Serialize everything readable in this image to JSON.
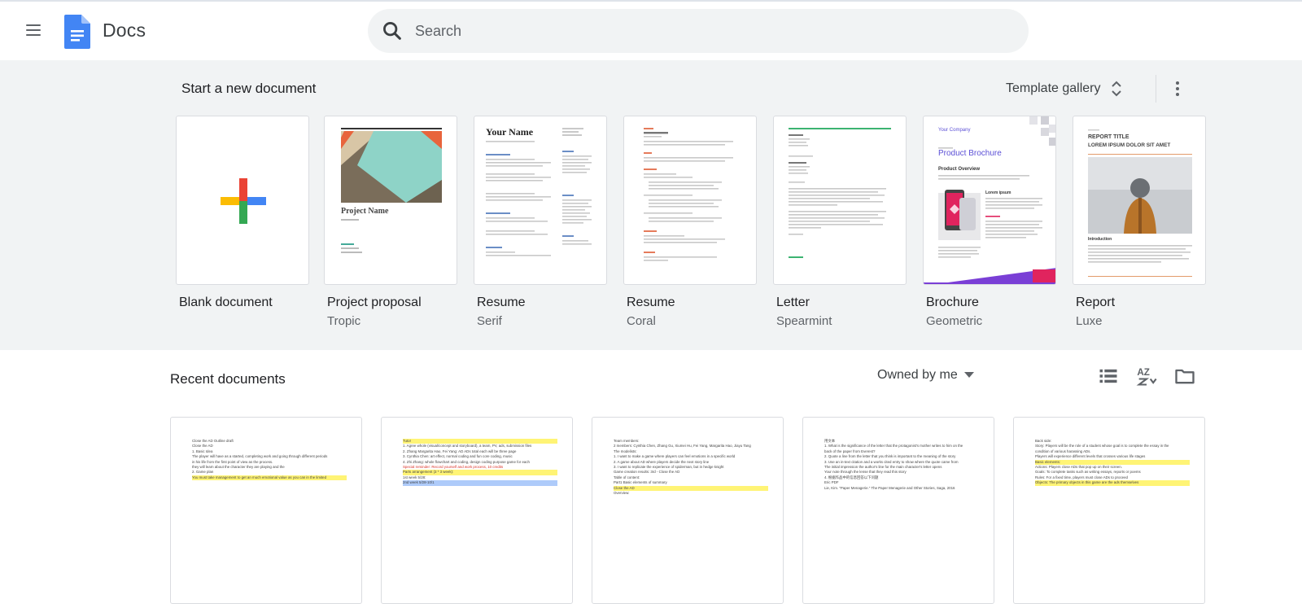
{
  "app": {
    "name": "Docs"
  },
  "search": {
    "placeholder": "Search"
  },
  "templates_section": {
    "title": "Start a new document",
    "gallery_label": "Template gallery",
    "items": [
      {
        "name": "Blank document",
        "subtitle": ""
      },
      {
        "name": "Project proposal",
        "subtitle": "Tropic"
      },
      {
        "name": "Resume",
        "subtitle": "Serif"
      },
      {
        "name": "Resume",
        "subtitle": "Coral"
      },
      {
        "name": "Letter",
        "subtitle": "Spearmint"
      },
      {
        "name": "Brochure",
        "subtitle": "Geometric"
      },
      {
        "name": "Report",
        "subtitle": "Luxe"
      }
    ],
    "thumb_text": {
      "project_name": "Project Name",
      "your_name": "Your Name",
      "company": "Your Company",
      "product_brochure": "Product Brochure",
      "product_overview": "Product Overview",
      "lorem_ipsum": "Lorem ipsum",
      "report_title": "REPORT TITLE",
      "report_sub": "LOREM IPSUM DOLOR SIT AMET",
      "introduction": "Introduction"
    }
  },
  "recent_section": {
    "title": "Recent documents",
    "filter_label": "Owned by me",
    "documents": [
      {
        "lines": [
          "Close the AD Outline draft",
          "Close the AD",
          "1. Basic Idea",
          "The player will have as a started, completing work and going through different periods",
          "in his life from the first point of view as the process.",
          "they will learn about the character they are playing and the",
          "2. Game plan",
          "You must take management to get an much emotional value as you can in the limited"
        ]
      },
      {
        "lines": [
          "Tutor",
          "1. Agree whole (visual/concept and storyboard), a team, PV, ads, submission files",
          "2. Zhang Margarita Hao, Fei Yang: AD ADs total each will be three page",
          "3. Cynthia Chen: art effect, normal coding and fun core coding, music",
          "4. Zhi Zhang: whole flowchart and coding, design coding purpose game for each",
          "Special reminder: Record yourself and work process, 10 credits",
          "Parts arrangement (3 * 3 week):",
          "1st week 5/28:",
          "2nd week 5/28-10/1"
        ]
      },
      {
        "lines": [
          "Team members:",
          "2 members: Cynthia Chen, Zhang Gu, Xiumei Hu, Fei Yang, Margarita Hao, Jiayu Tang",
          "The modelists:",
          "1. I want to make a game where players can feel emotions in a specific world",
          "2. A game about AD where players decide the next story line",
          "3. I want to replicate the experience of spiderman, but in hedge knight",
          "Game creation results: 3rd - Close the AD",
          "Table of content:",
          "Part1 Basic elements of summary",
          "Close the AD",
          "Overview:"
        ]
      },
      {
        "lines": [
          "用文本",
          "1. What is the significance of the letter that the protagonist's mother writes to him on the",
          "back of the paper from Everest?",
          "2. Quote a line from the letter that you think is important to the meaning of the story",
          "3. Use an in-text citation and a works cited entry to show where the quote came from",
          "The initial impression the author's line for the main character's letter opens",
          "Your note through the lense that they read this story",
          "4. 根据作品中的信息回答以下问题",
          "Eric PDF",
          "Lie, Kim. \"Paper Menagerie.\" The Paper Menagerie and Other Stories, Saga, 2016"
        ]
      },
      {
        "lines": [
          "Back side:",
          "Story: Players will be the role of a student whose goal is to complete the essay in the",
          "condition of various harassing ADs.",
          "Players will experience different levels that crosses various life stages",
          "Basic elements:",
          "Actions: Players close ADs that pop up on their screen.",
          "Goals: To complete tasks such as writing essays, reports or poems",
          "Rules: For a fixed time, players must close ADs to proceed",
          "Objects: The primary objects in this game are the ads themselves"
        ]
      }
    ]
  },
  "colors": {
    "docs_blue": "#4285f4",
    "template_bg": "#f1f3f4",
    "plus_blue": "#4285f4",
    "plus_red": "#ea4335",
    "plus_yellow": "#fbbc04",
    "plus_green": "#34a853"
  },
  "icons": [
    "menu-icon",
    "docs-logo-icon",
    "search-icon",
    "unfold-icon",
    "more-vert-icon",
    "list-view-icon",
    "sort-az-icon",
    "folder-icon",
    "dropdown-arrow-icon"
  ]
}
